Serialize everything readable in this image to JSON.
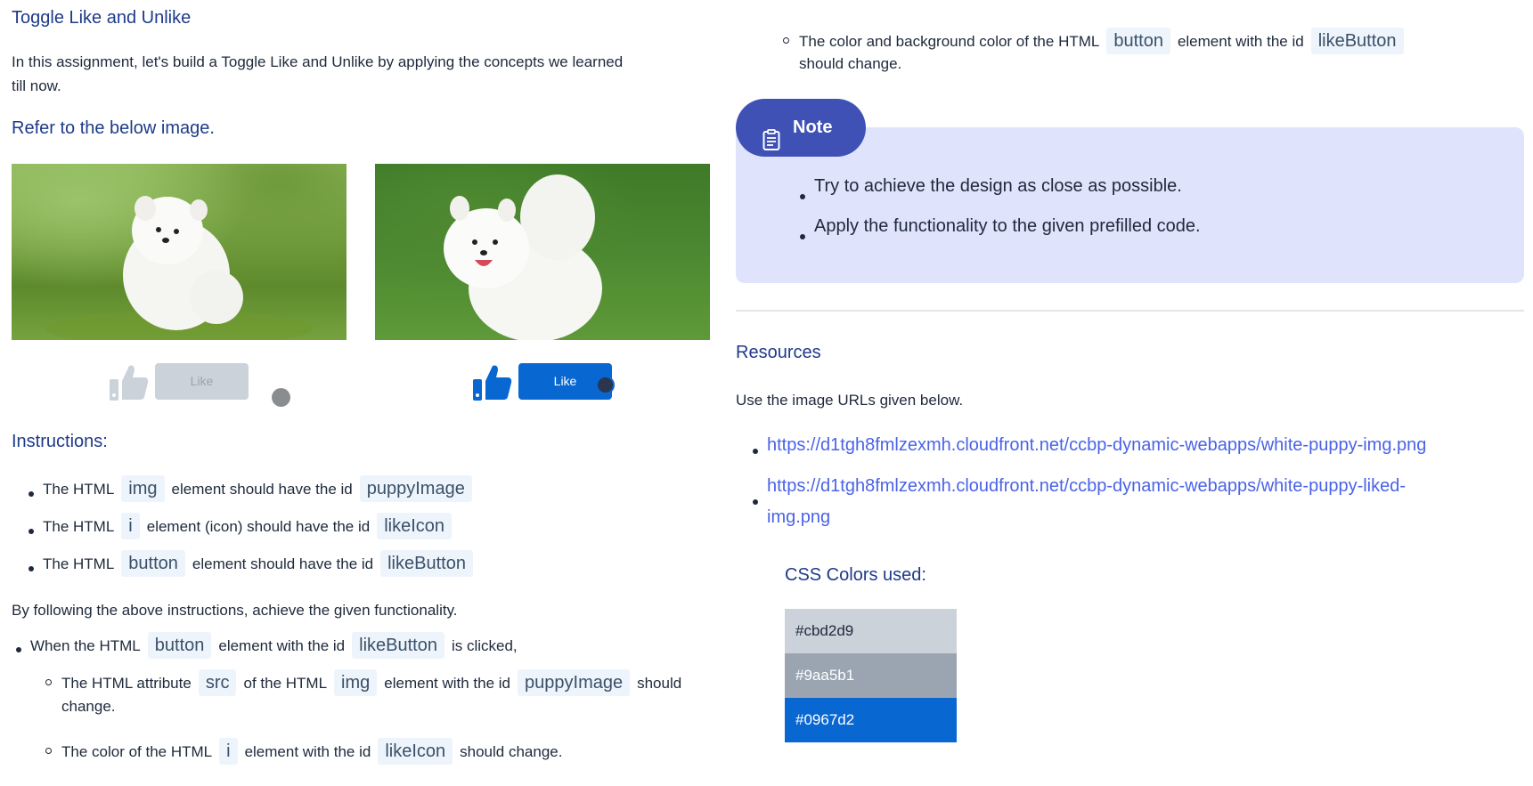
{
  "title": "Toggle Like and Unlike",
  "intro": "In this assignment, let's build a Toggle Like and Unlike by applying the concepts we learned till now.",
  "refer": "Refer to the below image.",
  "preview": {
    "like_label_off": "Like",
    "like_label_on": "Like"
  },
  "instructions_heading": "Instructions:",
  "instructions": [
    {
      "pre": "The HTML",
      "code1": "img",
      "mid": "element should have the id",
      "code2": "puppyImage"
    },
    {
      "pre": "The HTML",
      "code1": "i",
      "mid": "element (icon) should have the id",
      "code2": "likeIcon"
    },
    {
      "pre": "The HTML",
      "code1": "button",
      "mid": "element should have the id",
      "code2": "likeButton"
    }
  ],
  "follow_text": "By following the above instructions, achieve the given functionality.",
  "click": {
    "pre": "When the HTML",
    "code1": "button",
    "mid": "element with the id",
    "code2": "likeButton",
    "post": "is clicked,"
  },
  "sub1": {
    "pre": "The HTML attribute",
    "code1": "src",
    "mid1": "of the HTML",
    "code2": "img",
    "mid2": "element with the id",
    "code3": "puppyImage",
    "post": "should",
    "line2": "change."
  },
  "sub2": {
    "pre": "The color of the HTML",
    "code1": "i",
    "mid": "element with the id",
    "code2": "likeIcon",
    "post": "should change."
  },
  "sub3": {
    "pre": "The color and background color of the HTML",
    "code1": "button",
    "mid": "element with the id",
    "code2": "likeButton",
    "line2": "should change."
  },
  "note": {
    "label": "Note",
    "items": [
      "Try to achieve the design as close as possible.",
      "Apply the functionality to the given prefilled code."
    ]
  },
  "resources": {
    "heading": "Resources",
    "text": "Use the image URLs given below.",
    "url1": "https://d1tgh8fmlzexmh.cloudfront.net/ccbp-dynamic-webapps/white-puppy-img.png",
    "url2_line1": "https://d1tgh8fmlzexmh.cloudfront.net/ccbp-dynamic-webapps/white-puppy-liked-",
    "url2_line2": "img.png"
  },
  "colors": {
    "heading": "CSS Colors used:",
    "swatches": [
      "#cbd2d9",
      "#9aa5b1",
      "#0967d2"
    ]
  }
}
